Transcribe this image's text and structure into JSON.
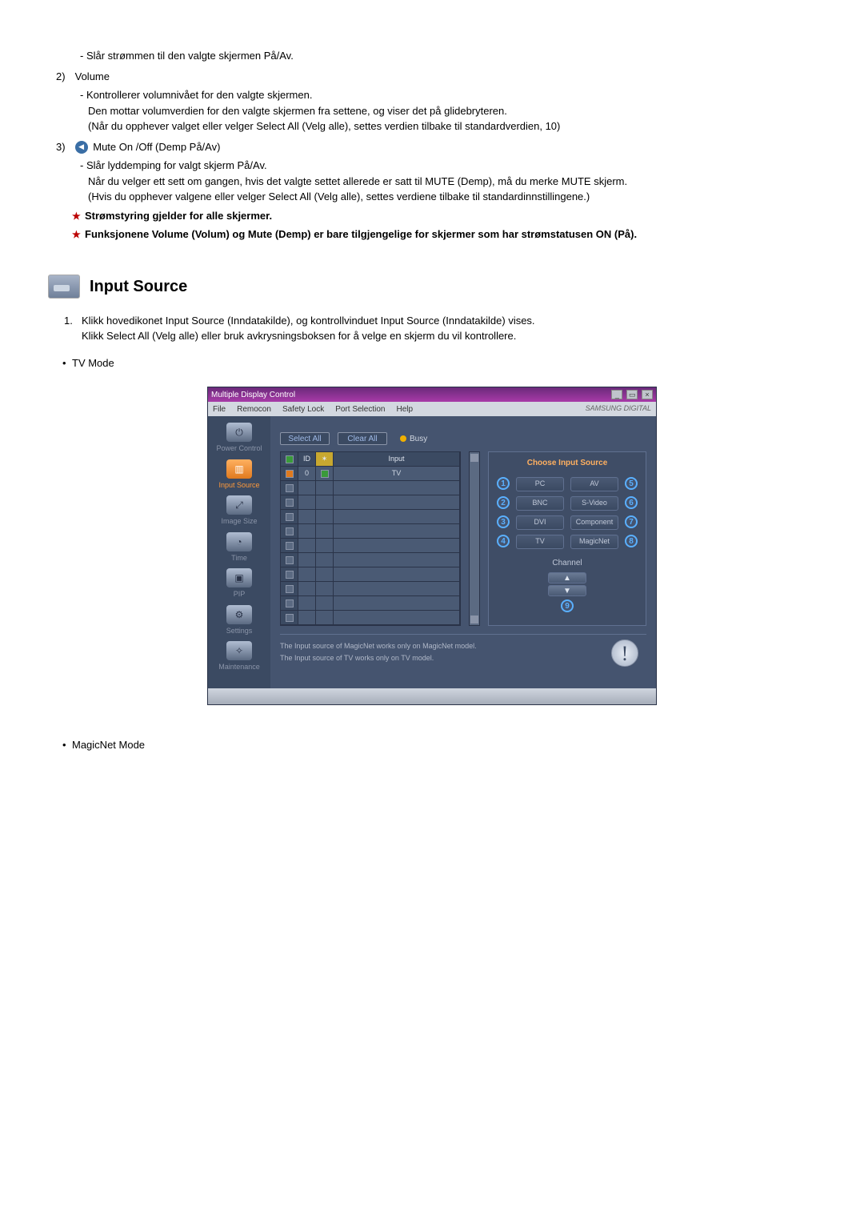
{
  "intro": {
    "power_line": "- Slår strømmen til den valgte skjermen På/Av.",
    "item2_num": "2)",
    "item2_title": "Volume",
    "item2_b1": "- Kontrollerer volumnivået for den valgte skjermen.",
    "item2_b2": "Den mottar volumverdien for den valgte skjermen fra settene, og viser det på glidebryteren.",
    "item2_b3": "(Når du opphever valget eller velger Select All (Velg alle), settes verdien tilbake til standardverdien, 10)",
    "item3_num": "3)",
    "item3_title": "Mute On /Off (Demp På/Av)",
    "item3_b1": "- Slår lyddemping for valgt skjerm På/Av.",
    "item3_b2": "Når du velger ett sett om gangen, hvis det valgte settet allerede er satt til MUTE (Demp), må du merke MUTE skjerm.",
    "item3_b3": "(Hvis du opphever valgene eller velger Select All (Velg alle), settes verdiene tilbake til standardinnstillingene.)",
    "star1": "Strømstyring gjelder for alle skjermer.",
    "star2": "Funksjonene Volume (Volum) og Mute (Demp) er bare tilgjengelige for skjermer som har strømstatusen ON (På)."
  },
  "section_title": "Input Source",
  "numlist": {
    "n1": "1.",
    "t1a": "Klikk hovedikonet Input Source (Inndatakilde), og kontrollvinduet Input Source (Inndatakilde) vises.",
    "t1b": "Klikk Select All (Velg alle) eller bruk avkrysningsboksen for å velge en skjerm du vil kontrollere."
  },
  "mode_tv": "TV Mode",
  "mode_magicnet": "MagicNet Mode",
  "ss": {
    "title": "Multiple Display Control",
    "menus": {
      "file": "File",
      "remocon": "Remocon",
      "safety": "Safety Lock",
      "port": "Port Selection",
      "help": "Help"
    },
    "brand": "SAMSUNG DIGITAL",
    "side": {
      "power": "Power Control",
      "input": "Input Source",
      "image": "Image Size",
      "time": "Time",
      "pip": "PIP",
      "settings": "Settings",
      "maint": "Maintenance"
    },
    "top": {
      "select_all": "Select All",
      "clear_all": "Clear All",
      "busy": "Busy"
    },
    "grid": {
      "id": "ID",
      "input": "Input",
      "row0_id": "0",
      "row0_input": "TV"
    },
    "choose": {
      "title": "Choose Input Source",
      "pc": "PC",
      "av": "AV",
      "bnc": "BNC",
      "svideo": "S-Video",
      "dvi": "DVI",
      "component": "Component",
      "tv": "TV",
      "magicnet": "MagicNet",
      "n1": "1",
      "n2": "2",
      "n3": "3",
      "n4": "4",
      "n5": "5",
      "n6": "6",
      "n7": "7",
      "n8": "8",
      "n9": "9",
      "channel": "Channel"
    },
    "notes": {
      "l1": "The Input source of MagicNet works only on MagicNet model.",
      "l2": "The Input source of TV works only on TV model."
    }
  }
}
